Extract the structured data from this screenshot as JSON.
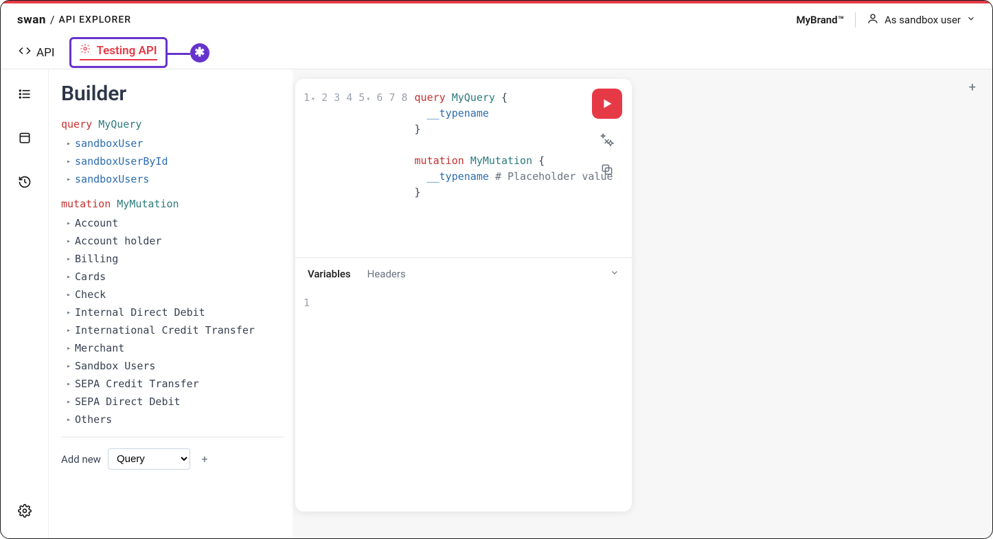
{
  "header": {
    "logo_text": "swan",
    "logo_separator": "/",
    "subtitle": "API EXPLORER",
    "brand": "MyBrand™",
    "user_mode": "As sandbox user"
  },
  "tabs": {
    "api": "API",
    "testing": "Testing API",
    "callout": "✱"
  },
  "rail": {
    "builder": "builder",
    "archive": "archive",
    "history": "history",
    "settings": "settings"
  },
  "builder": {
    "title": "Builder",
    "query_kw": "query",
    "query_name": "MyQuery",
    "query_fields": [
      "sandboxUser",
      "sandboxUserById",
      "sandboxUsers"
    ],
    "mutation_kw": "mutation",
    "mutation_name": "MyMutation",
    "mutation_groups": [
      "Account",
      "Account holder",
      "Billing",
      "Cards",
      "Check",
      "Internal Direct Debit",
      "International Credit Transfer",
      "Merchant",
      "Sandbox Users",
      "SEPA Credit Transfer",
      "SEPA Direct Debit",
      "Others"
    ],
    "add_new_label": "Add new",
    "add_new_select": "Query",
    "add_plus": "+"
  },
  "editor": {
    "lines": [
      {
        "n": "1",
        "fold": "▾"
      },
      {
        "n": "2"
      },
      {
        "n": "3"
      },
      {
        "n": "4"
      },
      {
        "n": "5",
        "fold": "▾"
      },
      {
        "n": "6"
      },
      {
        "n": "7"
      },
      {
        "n": "8"
      }
    ],
    "tokens": {
      "l1_kw": "query",
      "l1_name": "MyQuery",
      "l1_brace": "{",
      "l2_field": "__typename",
      "l3_brace": "}",
      "l5_kw": "mutation",
      "l5_name": "MyMutation",
      "l5_brace": "{",
      "l6_field": "__typename",
      "l6_comment": "# Placeholder value",
      "l7_brace": "}"
    },
    "vars_tab_active": "Variables",
    "vars_tab_headers": "Headers",
    "vars_line": "1"
  },
  "canvas": {
    "plus": "+"
  }
}
